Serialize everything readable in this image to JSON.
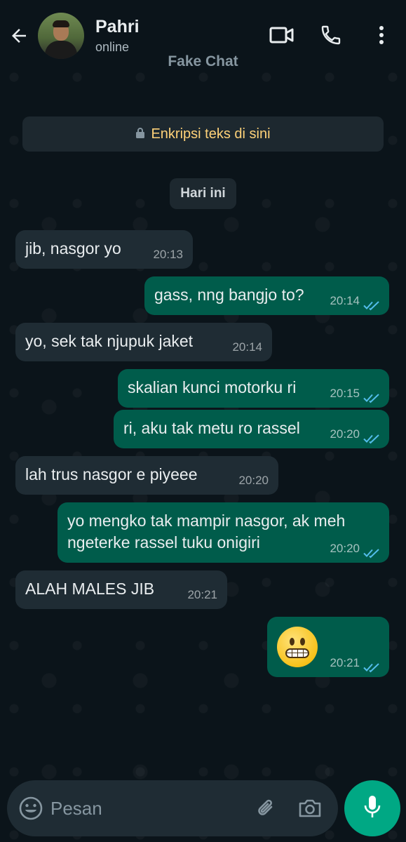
{
  "header": {
    "contact_name": "Pahri",
    "status": "online",
    "subtitle": "Fake Chat"
  },
  "encryption_notice": "Enkripsi teks di sini",
  "date_chip": "Hari ini",
  "messages": [
    {
      "direction": "in",
      "text": "jib, nasgor yo",
      "time": "20:13"
    },
    {
      "direction": "out",
      "text": "gass, nng bangjo to?",
      "time": "20:14",
      "read": true
    },
    {
      "direction": "in",
      "text": "yo, sek tak njupuk jaket",
      "time": "20:14"
    },
    {
      "direction": "out",
      "text": "skalian kunci motorku ri",
      "time": "20:15",
      "read": true
    },
    {
      "direction": "out",
      "text": "ri, aku tak metu ro rassel",
      "time": "20:20",
      "read": true
    },
    {
      "direction": "in",
      "text": "lah trus nasgor e piyeee",
      "time": "20:20"
    },
    {
      "direction": "out",
      "text_line1": "yo mengko tak mampir nasgor, ak meh",
      "text_line2": "ngeterke rassel tuku onigiri",
      "time": "20:20",
      "read": true
    },
    {
      "direction": "in",
      "text": "ALAH MALES JIB",
      "time": "20:21"
    },
    {
      "direction": "out",
      "emoji": "grimacing-face",
      "time": "20:21",
      "read": true
    }
  ],
  "composer": {
    "placeholder": "Pesan"
  },
  "colors": {
    "background": "#0b141a",
    "incoming_bubble": "#1f2c34",
    "outgoing_bubble": "#005c4b",
    "read_ticks": "#53bdeb",
    "encryption_text": "#ffd279",
    "mic_button": "#00a884"
  }
}
